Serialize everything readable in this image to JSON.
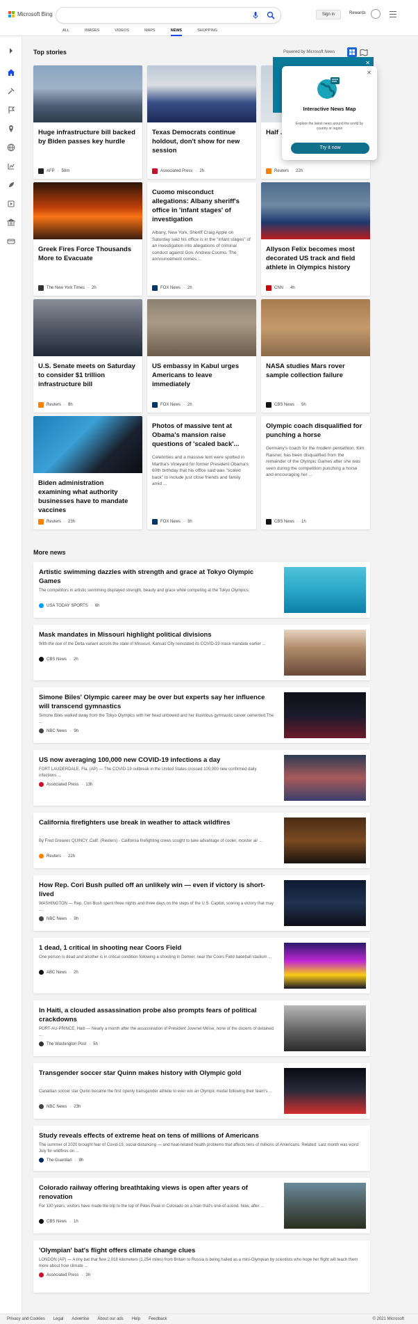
{
  "header": {
    "brand": "Microsoft Bing",
    "search_placeholder": "",
    "signin": "Sign in",
    "rewards": "Rewards",
    "tabs": [
      "ALL",
      "IMAGES",
      "VIDEOS",
      "MAPS",
      "NEWS",
      "SHOPPING"
    ],
    "active_tab": "NEWS"
  },
  "top_stories": {
    "title": "Top stories",
    "powered_by": "Powered by Microsoft News",
    "cards": [
      {
        "title": "Huge infrastructure bill backed by Biden passes key hurdle",
        "desc": "",
        "source": "AFP",
        "time": "58m"
      },
      {
        "title": "Texas Democrats continue holdout, don't show for new session",
        "desc": "",
        "source": "Associated Press",
        "time": "2h"
      },
      {
        "title": "Half ... vacci... CDC",
        "desc": "",
        "source": "Reuters",
        "time": "22h"
      },
      {
        "title": "Greek Fires Force Thousands More to Evacuate",
        "desc": "",
        "source": "The New York Times",
        "time": "2h"
      },
      {
        "title": "Cuomo misconduct allegations: Albany sheriff's office in 'infant stages' of investigation",
        "desc": "Albany, New York, Sheriff Craig Apple on Saturday said his office is in the \"infant stages\" of an investigation into allegations of criminal conduct against Gov. Andrew Cuomo. The announcement comes ...",
        "source": "FOX News",
        "time": "2h"
      },
      {
        "title": "Allyson Felix becomes most decorated US track and field athlete in Olympics history",
        "desc": "",
        "source": "CNN",
        "time": "4h"
      },
      {
        "title": "U.S. Senate meets on Saturday to consider $1 trillion infrastructure bill",
        "desc": "",
        "source": "Reuters",
        "time": "8h"
      },
      {
        "title": "US embassy in Kabul urges Americans to leave immediately",
        "desc": "",
        "source": "FOX News",
        "time": "2h"
      },
      {
        "title": "NASA studies Mars rover sample collection failure",
        "desc": "",
        "source": "CBS News",
        "time": "5h"
      },
      {
        "title": "Biden administration examining what authority businesses have to mandate vaccines",
        "desc": "",
        "source": "Reuters",
        "time": "23h"
      },
      {
        "title": "Photos of massive tent at Obama's mansion raise questions of 'scaled back'...",
        "desc": "Celebrities and a massive tent were spotted in Martha's Vineyard for former President Obama's 60th birthday that his office said was \"scaled back\" to include just close friends and family amid ...",
        "source": "FOX News",
        "time": "3h"
      },
      {
        "title": "Olympic coach disqualified for punching a horse",
        "desc": "Germany's coach for the modern pentathlon, Kim Raisner, has been disqualified from the remainder of the Olympic Games after she was seen during the competition punching a horse and encouraging her ...",
        "source": "CBS News",
        "time": "1h"
      }
    ]
  },
  "popup": {
    "title": "Interactive News Map",
    "desc": "Explore the latest news around the world by country or region",
    "cta": "Try it now"
  },
  "more_news": {
    "title": "More news",
    "items": [
      {
        "title": "Artistic swimming dazzles with strength and grace at Tokyo Olympic Games",
        "desc": "The competitors in artistic swimming displayed strength, beauty and grace while competing at the Tokyo Olympics.",
        "source": "USA TODAY SPORTS",
        "time": "6h"
      },
      {
        "title": "Mask mandates in Missouri highlight political divisions",
        "desc": "With the rise of the Delta variant across the state of Missouri, Kansas City reinstated its COVID-19 mask mandate earlier ...",
        "source": "CBS News",
        "time": "2h"
      },
      {
        "title": "Simone Biles' Olympic career may be over but experts say her influence will transcend gymnastics",
        "desc": "Simone Biles walked away from the Tokyo Olympics with her head unbowed and her illustrious gymnastic career cemented.The ...",
        "source": "NBC News",
        "time": "9h"
      },
      {
        "title": "US now averaging 100,000 new COVID-19 infections a day",
        "desc": "FORT LAUDERDALE, Fla. (AP) — The COVID-19 outbreak in the United States crossed 100,000 new confirmed daily infections ...",
        "source": "Associated Press",
        "time": "13h"
      },
      {
        "title": "California firefighters use break in weather to attack wildfires",
        "desc": "By Fred Greaves QUINCY, Calif. (Reuters) - California firefighting crews sought to take advantage of cooler, moister air ...",
        "source": "Reuters",
        "time": "22h"
      },
      {
        "title": "How Rep. Cori Bush pulled off an unlikely win — even if victory is short-lived",
        "desc": "WASHINGTON — Rep. Cori Bush spent three nights and three days on the steps of the U.S. Capitol, scoring a victory that may ...",
        "source": "NBC News",
        "time": "9h"
      },
      {
        "title": "1 dead, 1 critical in shooting near Coors Field",
        "desc": "One person is dead and another is in critical condition following a shooting in Denver, near the Coors Field baseball stadium ...",
        "source": "ABC News",
        "time": "2h"
      },
      {
        "title": "In Haiti, a clouded assassination probe also prompts fears of political crackdowns",
        "desc": "PORT-AU-PRINCE, Haiti — Nearly a month after the assassination of President Jovenel Moïse, none of the dozens of detained ...",
        "source": "The Washington Post",
        "time": "5h"
      },
      {
        "title": "Transgender soccer star Quinn makes history with Olympic gold",
        "desc": "Canadian soccer star Quinn became the first openly transgender athlete to ever win an Olympic medal following their team's ...",
        "source": "NBC News",
        "time": "23h"
      },
      {
        "title": "Study reveals effects of extreme heat on tens of millions of Americans",
        "desc": "The summer of 2020 brought fear of Covid-19, social distancing — and heat-related health problems that affects tens of millions of Americans. Related: Last month was worst July for wildfires on ...",
        "source": "The Guardian",
        "time": "8h"
      },
      {
        "title": "Colorado railway offering breathtaking views is open after years of renovation",
        "desc": "For 130 years, visitors have made the trip to the top of Pikes Peak in Colorado on a train that's one-of-a-kind. Now, after ...",
        "source": "CBS News",
        "time": "1h"
      },
      {
        "title": "'Olympian' bat's flight offers climate change clues",
        "desc": "LONDON (AP) — A tiny bat that flew 2,018 kilometers (1,254 miles) from Britain to Russia is being hailed as a mini-Olympian by scientists who hope her flight will teach them more about how climate ...",
        "source": "Associated Press",
        "time": "3h"
      }
    ]
  },
  "footer": {
    "links": [
      "Privacy and Cookies",
      "Legal",
      "Advertise",
      "About our ads",
      "Help",
      "Feedback"
    ],
    "copyright": "© 2021 Microsoft"
  },
  "colors": {
    "accent": "#174ae4",
    "teal": "#0e6f8a"
  }
}
